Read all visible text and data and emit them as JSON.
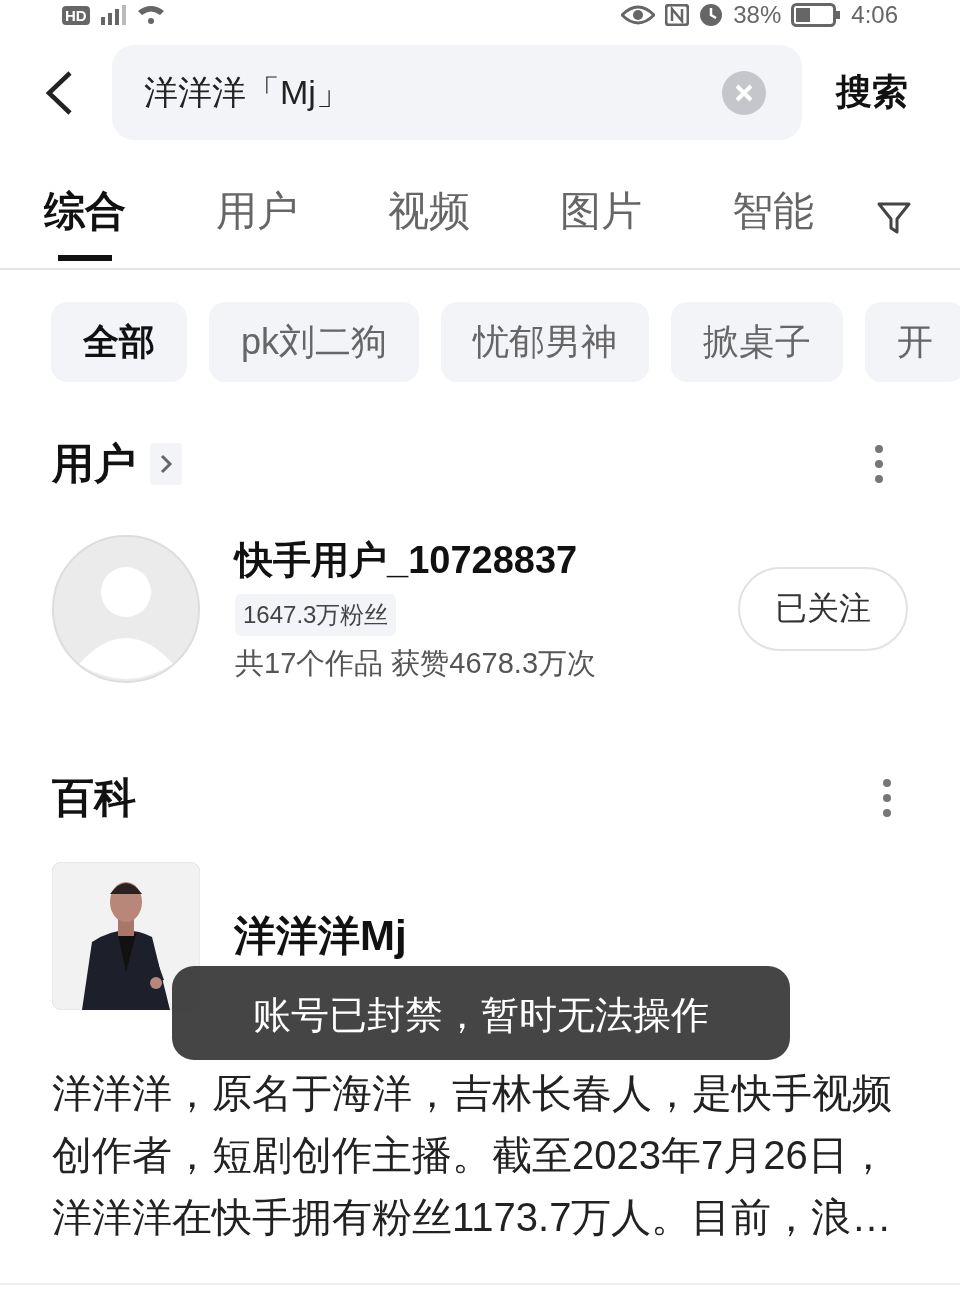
{
  "status_bar": {
    "network_badge": "HD",
    "battery": "38%",
    "time": "4:06"
  },
  "search": {
    "value": "洋洋洋「Mj」",
    "button": "搜索"
  },
  "tabs": [
    {
      "label": "综合",
      "selected": true
    },
    {
      "label": "用户",
      "selected": false
    },
    {
      "label": "视频",
      "selected": false
    },
    {
      "label": "图片",
      "selected": false
    },
    {
      "label": "智能",
      "selected": false
    }
  ],
  "chips": [
    {
      "label": "全部",
      "selected": true
    },
    {
      "label": "pk刘二狗",
      "selected": false
    },
    {
      "label": "忧郁男神",
      "selected": false
    },
    {
      "label": "掀桌子",
      "selected": false
    },
    {
      "label": "开",
      "selected": false
    }
  ],
  "users_section": {
    "title": "用户",
    "user": {
      "name": "快手用户_10728837",
      "followers": "1647.3万粉丝",
      "stats": "共17个作品 获赞4678.3万次",
      "follow_button": "已关注"
    }
  },
  "wiki_section": {
    "title": "百科",
    "entry_title": "洋洋洋Mj",
    "summary": "洋洋洋，原名于海洋，吉林长春人，是快手视频创作者，短剧创作主播。截至2023年7月26日，洋洋洋在快手拥有粉丝1173.7万人。目前，浪…"
  },
  "toast": "账号已封禁，暂时无法操作"
}
